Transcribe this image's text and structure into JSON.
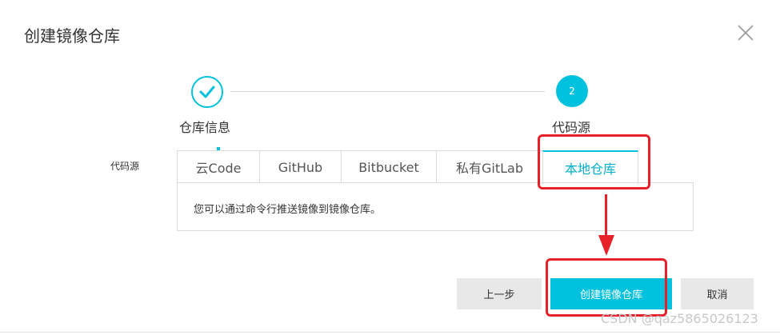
{
  "dialog": {
    "title": "创建镜像仓库",
    "close_icon": "close-icon"
  },
  "steps": [
    {
      "label": "仓库信息",
      "status": "completed",
      "icon": "check-icon"
    },
    {
      "label": "代码源",
      "status": "active",
      "number": "2"
    }
  ],
  "form": {
    "field_label": "代码源",
    "tabs": [
      {
        "label": "云Code"
      },
      {
        "label": "GitHub"
      },
      {
        "label": "Bitbucket"
      },
      {
        "label": "私有GitLab"
      },
      {
        "label": "本地仓库",
        "active": true
      }
    ],
    "content_text": "您可以通过命令行推送镜像到镜像仓库。"
  },
  "footer": {
    "prev_label": "上一步",
    "create_label": "创建镜像仓库",
    "cancel_label": "取消"
  },
  "watermark": "CSDN @qaz5865026123",
  "colors": {
    "accent": "#00c1de",
    "annotation": "#e8202a",
    "secondary_button": "#e8e8e8"
  }
}
